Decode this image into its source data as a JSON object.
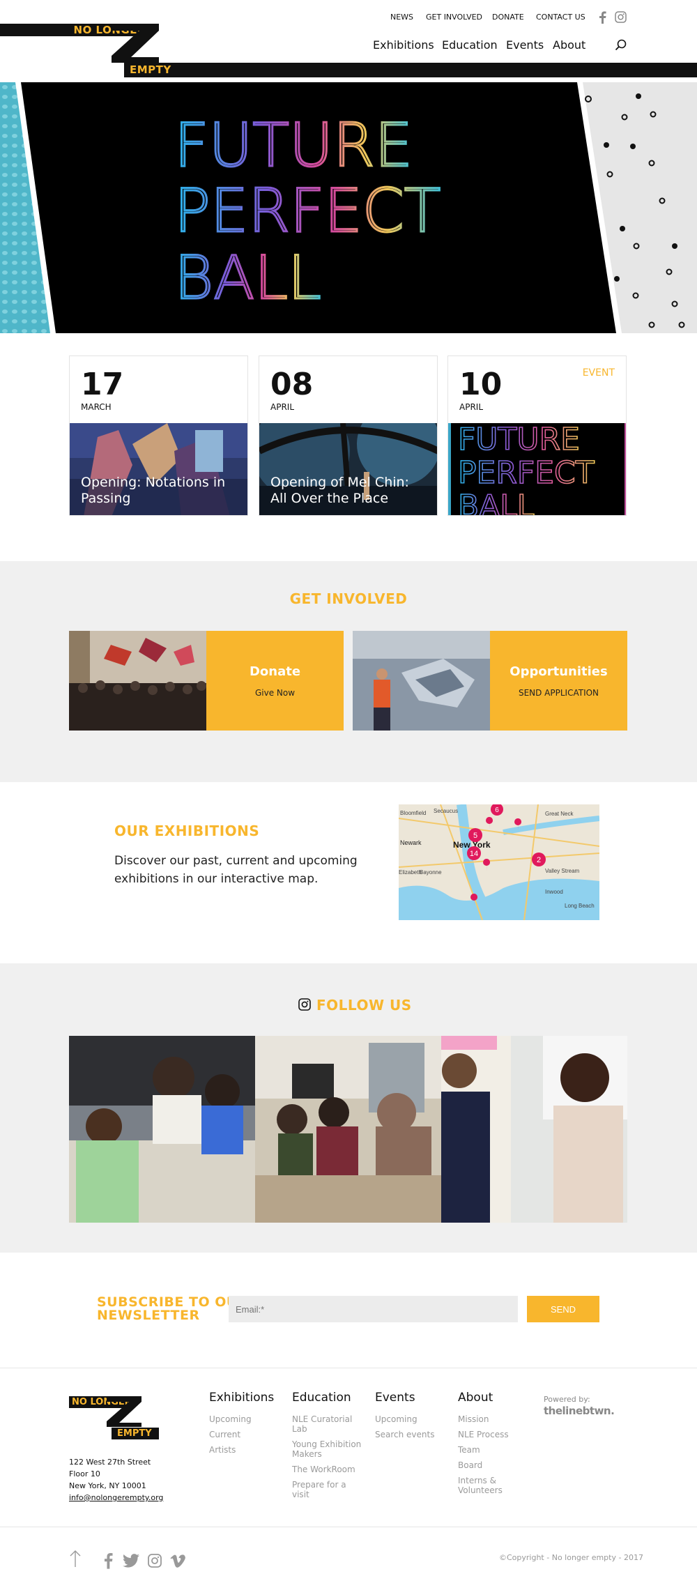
{
  "header": {
    "logo_top": "NO LONGER",
    "logo_bottom": "EMPTY",
    "top_links": [
      "NEWS",
      "GET INVOLVED",
      "DONATE",
      "CONTACT US"
    ],
    "main_nav": [
      "Exhibitions",
      "Education",
      "Events",
      "About"
    ]
  },
  "hero": {
    "lines": [
      "FUTURE",
      "PERFECT",
      "BALL"
    ]
  },
  "events": [
    {
      "day": "17",
      "month": "MARCH",
      "tag": "",
      "title": "Opening: Notations in Passing"
    },
    {
      "day": "08",
      "month": "APRIL",
      "tag": "",
      "title": "Opening of Mel Chin: All Over the Place"
    },
    {
      "day": "10",
      "month": "APRIL",
      "tag": "EVENT",
      "title": "",
      "image_lines": [
        "FUTURE",
        "PERFECT",
        "BALL"
      ]
    }
  ],
  "get_involved": {
    "title": "GET INVOLVED",
    "boxes": [
      {
        "title": "Donate",
        "subtitle": "Give Now"
      },
      {
        "title": "Opportunities",
        "subtitle": "SEND APPLICATION"
      }
    ]
  },
  "exhibitions": {
    "title": "OUR EXHIBITIONS",
    "text": "Discover our past, current and upcoming exhibitions in our interactive map.",
    "map_labels": [
      "Bloomfield",
      "Secaucus",
      "Newark",
      "New York",
      "Bayonne",
      "Great Neck",
      "Valley Stream",
      "Long Beach",
      "Elizabeth",
      "Inwood"
    ],
    "pins": [
      "6",
      "5",
      "14",
      "2"
    ]
  },
  "follow": {
    "title": "FOLLOW US"
  },
  "newsletter": {
    "title_line1": "SUBSCRIBE TO OUR",
    "title_line2": "NEWSLETTER",
    "placeholder": "Email:*",
    "send": "SEND"
  },
  "footer": {
    "logo_top": "NO LONGER",
    "logo_bottom": "EMPTY",
    "address": [
      "122 West 27th Street",
      "Floor 10",
      "New York, NY 10001"
    ],
    "email": "info@nolongerempty.org",
    "columns": [
      {
        "heading": "Exhibitions",
        "links": [
          "Upcoming",
          "Current",
          "Artists"
        ]
      },
      {
        "heading": "Education",
        "links": [
          "NLE Curatorial Lab",
          "Young Exhibition Makers",
          "The WorkRoom",
          "Prepare for a visit"
        ]
      },
      {
        "heading": "Events",
        "links": [
          "Upcoming",
          "Search events"
        ]
      },
      {
        "heading": "About",
        "links": [
          "Mission",
          "NLE Process",
          "Team",
          "Board",
          "Interns & Volunteers"
        ]
      }
    ],
    "powered_by": "Powered by:",
    "powered_brand": "thelinebtwn.",
    "copyright": "©Copyright - No longer empty - 2017"
  },
  "colors": {
    "accent": "#f8b62d",
    "dark": "#111111",
    "pin": "#e0195c",
    "grey_bg": "#f0f0f0"
  }
}
